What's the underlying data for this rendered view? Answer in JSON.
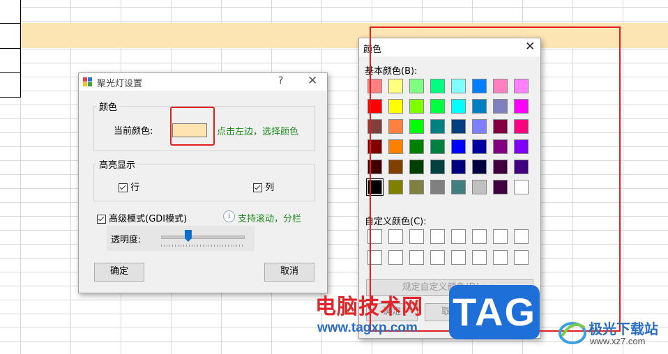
{
  "spotlight": {
    "title": "聚光灯设置",
    "help": "?",
    "close": "✕",
    "color_group": "颜色",
    "current_color_label": "当前颜色:",
    "current_color": "#fde4b0",
    "click_hint": "点击左边，选择颜色",
    "highlight_group": "高亮显示",
    "row_label": "行",
    "col_label": "列",
    "advanced_label": "高级模式(GDI模式)",
    "advanced_hint": "支持滚动，分栏",
    "opacity_label": "透明度:",
    "opacity_value": 0.33,
    "ok": "确定",
    "cancel": "取消"
  },
  "color_dialog": {
    "title": "颜色",
    "close": "✕",
    "basic_label": "基本颜色(B):",
    "custom_label": "自定义颜色(C):",
    "define_button": "规定自定义颜色(D) >>",
    "ok": "确定",
    "cancel": "取消",
    "basic_colors": [
      "#ff8080",
      "#ffff80",
      "#80ff80",
      "#00ff80",
      "#80ffff",
      "#0080ff",
      "#ff80c0",
      "#ff80ff",
      "#ff0000",
      "#ffff00",
      "#80ff00",
      "#00ff40",
      "#00ffff",
      "#0080c0",
      "#8080c0",
      "#ff00ff",
      "#804040",
      "#ff8040",
      "#00ff00",
      "#008080",
      "#004080",
      "#8080ff",
      "#800040",
      "#ff0080",
      "#800000",
      "#ff8000",
      "#008000",
      "#008040",
      "#0000ff",
      "#0000a0",
      "#800080",
      "#8000ff",
      "#400000",
      "#804000",
      "#004000",
      "#004040",
      "#000080",
      "#000040",
      "#400040",
      "#400080",
      "#000000",
      "#808000",
      "#808040",
      "#808080",
      "#408080",
      "#c0c0c0",
      "#400040",
      "#ffffff"
    ]
  },
  "watermarks": {
    "site_name": "电脑技术网",
    "site_url": "www.tagxp.com",
    "tag_logo": "TAG",
    "brand2": "极光下载站",
    "brand2_url": "www.xz7.com"
  }
}
